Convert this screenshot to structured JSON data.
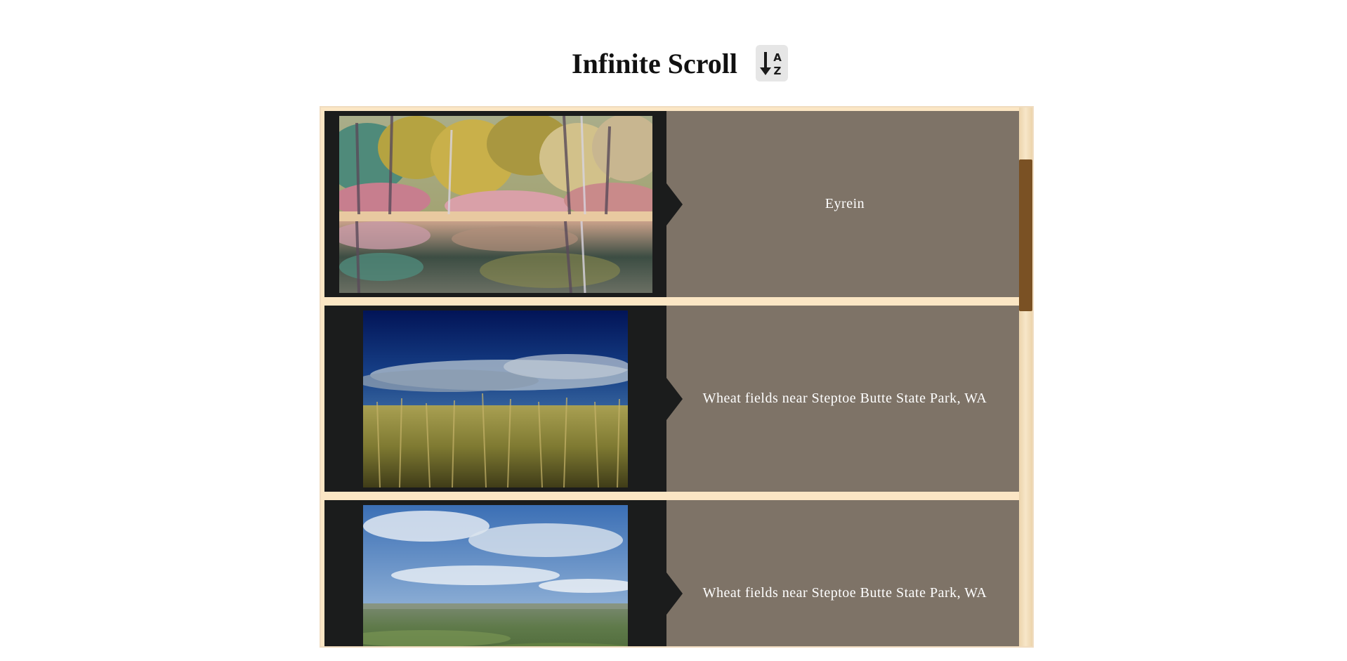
{
  "header": {
    "title": "Infinite Scroll",
    "sort_button_icon": "sort-alpha-down-icon"
  },
  "feed": {
    "items": [
      {
        "caption": "Eyrein"
      },
      {
        "caption": "Wheat fields near Steptoe Butte State Park, WA"
      },
      {
        "caption": "Wheat fields near Steptoe Butte State Park, WA"
      }
    ]
  },
  "colors": {
    "feed_background": "#fbe6c4",
    "media_background": "#1b1c1c",
    "caption_background": "#7e7367",
    "scroll_thumb": "#7a5124"
  }
}
